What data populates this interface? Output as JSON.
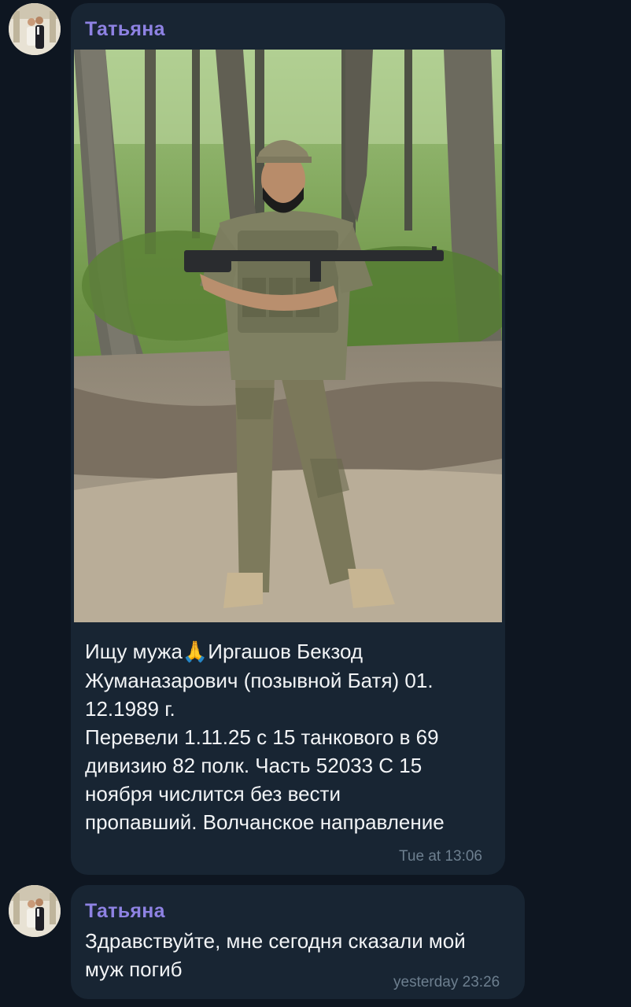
{
  "messages": [
    {
      "sender": "Татьяна",
      "text_part1": "Ищу мужа",
      "emoji_icon": "praying-hands-icon",
      "emoji_glyph": "🙏",
      "text_part2": "Иргашов Бекзод\nЖуманазарович (позывной Батя) 01.\n12.1989 г.\nПеревели 1.11.25 с 15 танкового в 69\nдивизию 82 полк. Часть 52033 С 15\nноября числится без вести\nпропавший. Волчанское направление",
      "time": "Tue at 13:06"
    },
    {
      "sender": "Татьяна",
      "text": "Здравствуйте, мне сегодня сказали мой\nмуж погиб",
      "time": "yesterday 23:26"
    }
  ],
  "colors": {
    "background": "#0e1621",
    "bubble": "#182533",
    "sender_name": "#8e82e3",
    "text": "#f2f4f6",
    "timestamp": "#6d7f8f"
  }
}
